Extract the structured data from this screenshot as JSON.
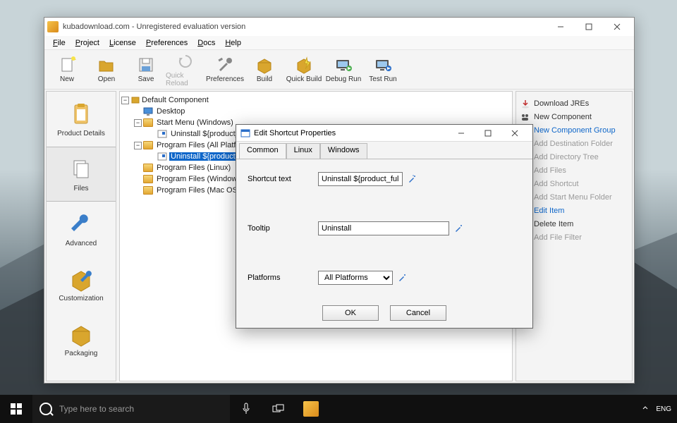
{
  "window": {
    "title": "kubadownload.com - Unregistered evaluation version"
  },
  "menubar": [
    "File",
    "Project",
    "License",
    "Preferences",
    "Docs",
    "Help"
  ],
  "toolbar": [
    {
      "label": "New",
      "icon": "new"
    },
    {
      "label": "Open",
      "icon": "open"
    },
    {
      "label": "Save",
      "icon": "save"
    },
    {
      "label": "Quick Reload",
      "icon": "reload",
      "disabled": true
    },
    {
      "label": "Preferences",
      "icon": "prefs"
    },
    {
      "label": "Build",
      "icon": "build"
    },
    {
      "label": "Quick Build",
      "icon": "qbuild"
    },
    {
      "label": "Debug Run",
      "icon": "drun"
    },
    {
      "label": "Test Run",
      "icon": "trun"
    }
  ],
  "leftnav": [
    {
      "label": "Product Details",
      "icon": "clipboard"
    },
    {
      "label": "Files",
      "icon": "files",
      "selected": true
    },
    {
      "label": "Advanced",
      "icon": "wrench"
    },
    {
      "label": "Customization",
      "icon": "box-wrench"
    },
    {
      "label": "Packaging",
      "icon": "box"
    }
  ],
  "tree": {
    "root": "Default Component",
    "items": [
      {
        "indent": 12,
        "icon": "desktop",
        "label": "Desktop"
      },
      {
        "indent": 12,
        "exp": "-",
        "icon": "folder",
        "label": "Start Menu (Windows)"
      },
      {
        "indent": 32,
        "icon": "shortcut",
        "label": "Uninstall ${product_fullname}"
      },
      {
        "indent": 12,
        "exp": "-",
        "icon": "folder",
        "label": "Program Files (All Platforms)"
      },
      {
        "indent": 32,
        "icon": "shortcut",
        "label": "Uninstall ${product_fullname}",
        "selected": true
      },
      {
        "indent": 12,
        "icon": "folder",
        "label": "Program Files (Linux)"
      },
      {
        "indent": 12,
        "icon": "folder",
        "label": "Program Files (Windows)"
      },
      {
        "indent": 12,
        "icon": "folder",
        "label": "Program Files (Mac OS X)"
      }
    ]
  },
  "rightpanel": [
    {
      "icon": "download",
      "label": "Download JREs",
      "cls": ""
    },
    {
      "icon": "component",
      "label": "New Component",
      "cls": ""
    },
    {
      "icon": "group",
      "label": "New Component Group",
      "cls": "blue"
    },
    {
      "icon": "folder-gray",
      "label": "Add Destination Folder",
      "cls": "disabled"
    },
    {
      "icon": "folder-gray",
      "label": "Add Directory Tree",
      "cls": "disabled"
    },
    {
      "icon": "file-gray",
      "label": "Add Files",
      "cls": "disabled"
    },
    {
      "icon": "shortcut-gray",
      "label": "Add Shortcut",
      "cls": "disabled"
    },
    {
      "icon": "folder-gray",
      "label": "Add Start Menu Folder",
      "cls": "disabled"
    },
    {
      "icon": "edit",
      "label": "Edit Item",
      "cls": "blue"
    },
    {
      "icon": "delete",
      "label": "Delete Item",
      "cls": ""
    },
    {
      "icon": "filter-gray",
      "label": "Add File Filter",
      "cls": "disabled"
    }
  ],
  "dialog": {
    "title": "Edit Shortcut Properties",
    "tabs": [
      "Common",
      "Linux",
      "Windows"
    ],
    "fields": {
      "shortcut_text_label": "Shortcut text",
      "shortcut_text_value": "Uninstall ${product_ful",
      "tooltip_label": "Tooltip",
      "tooltip_value": "Uninstall",
      "platforms_label": "Platforms",
      "platforms_value": "All Platforms"
    },
    "ok": "OK",
    "cancel": "Cancel"
  },
  "taskbar": {
    "search_placeholder": "Type here to search",
    "lang": "ENG"
  }
}
